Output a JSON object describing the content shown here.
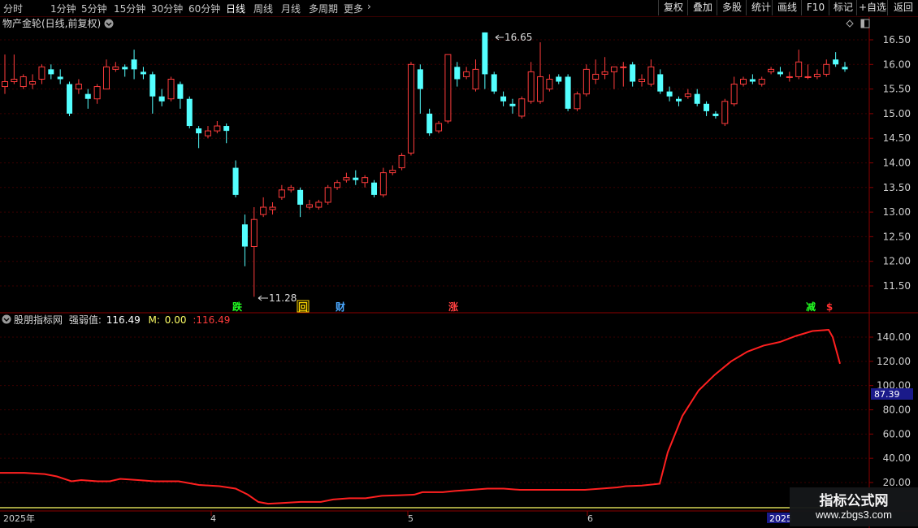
{
  "toolbar": {
    "periods": [
      "分时",
      "1分钟",
      "5分钟",
      "15分钟",
      "30分钟",
      "60分钟",
      "日线",
      "周线",
      "月线",
      "多周期",
      "更多"
    ],
    "active_period": "日线",
    "right_buttons": [
      "复权",
      "叠加",
      "多股",
      "统计",
      "画线",
      "F10",
      "标记",
      "+自选",
      "返回"
    ]
  },
  "main_chart": {
    "title": "物产金轮(日线,前复权)",
    "y_ticks": [
      "16.50",
      "16.00",
      "15.50",
      "15.00",
      "14.50",
      "14.00",
      "13.50",
      "13.00",
      "12.50",
      "12.00",
      "11.50"
    ],
    "high_label": "16.65",
    "low_label": "11.28",
    "markers": [
      {
        "text": "跌",
        "color": "#22ff22",
        "boxed": false
      },
      {
        "text": "回",
        "color": "#ffd700",
        "boxed": true
      },
      {
        "text": "财",
        "color": "#4aa8ff",
        "boxed": false
      },
      {
        "text": "涨",
        "color": "#ff4040",
        "boxed": false
      },
      {
        "text": "减",
        "color": "#22ff22",
        "boxed": false
      },
      {
        "text": "$",
        "color": "#ff3030",
        "boxed": false
      }
    ],
    "colors": {
      "up": "#ff3c3c",
      "down": "#54ffff",
      "grid": "#3a0000",
      "axis": "#8b0000"
    }
  },
  "indicator": {
    "name": "股朋指标网",
    "label": "强弱值:",
    "value": "116.49",
    "m_label": "M:",
    "m_value": "0.00",
    "extra": ":116.49",
    "y_ticks": [
      "140.00",
      "120.00",
      "100.00",
      "80.00",
      "60.00",
      "40.00",
      "20.00"
    ],
    "current_tag": "87.39"
  },
  "x_axis": {
    "labels": [
      "2025年",
      "4",
      "5",
      "6",
      "2025"
    ]
  },
  "watermark": {
    "line1": "指标公式网",
    "line2": "www.zbgs3.com"
  }
}
